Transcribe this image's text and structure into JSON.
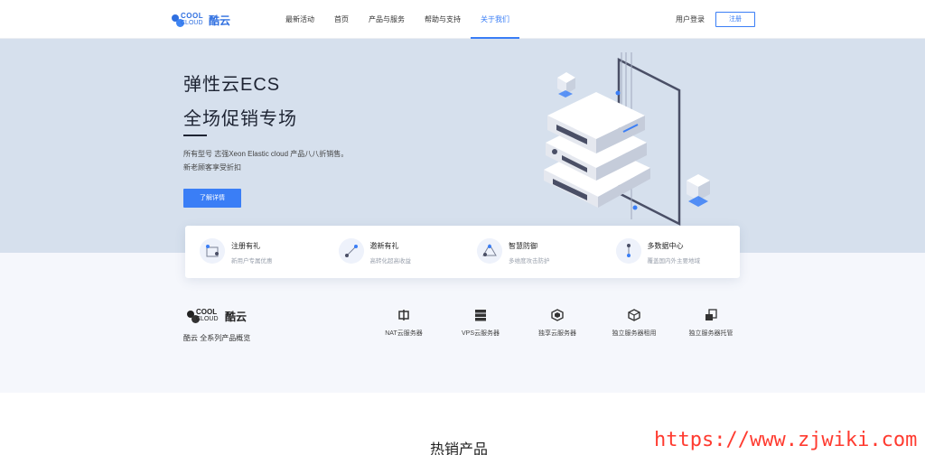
{
  "header": {
    "logo_text_en_top": "COOL",
    "logo_text_en_bottom": "CLOUD",
    "logo_text_cn": "酷云",
    "nav": [
      {
        "label": "最新活动",
        "active": false
      },
      {
        "label": "首页",
        "active": false
      },
      {
        "label": "产品与服务",
        "active": false
      },
      {
        "label": "帮助与支持",
        "active": false
      },
      {
        "label": "关于我们",
        "active": true
      }
    ],
    "login_label": "用户登录",
    "register_label": "注册"
  },
  "hero": {
    "title_line1": "弹性云ECS",
    "title_line2": "全场促销专场",
    "desc_line1": "所有型号 志强Xeon Elastic cloud 产品八八折销售。",
    "desc_line2": "新老顾客享受折扣",
    "cta_label": "了解详情"
  },
  "features": [
    {
      "title": "注册有礼",
      "subtitle": "新用户专属优惠",
      "icon": "gift-icon"
    },
    {
      "title": "邀新有礼",
      "subtitle": "高转化超高收益",
      "icon": "invite-icon"
    },
    {
      "title": "智慧防御",
      "subtitle": "多维度攻击防护",
      "icon": "shield-icon"
    },
    {
      "title": "多数据中心",
      "subtitle": "覆盖国内外主要地域",
      "icon": "datacenter-icon"
    }
  ],
  "overview": {
    "logo_text_en_top": "COOL",
    "logo_text_en_bottom": "CLOUD",
    "logo_text_cn": "酷云",
    "title": "酷云 全系列产品概览",
    "products": [
      {
        "label": "NAT云服务器",
        "icon": "nat-icon"
      },
      {
        "label": "VPS云服务器",
        "icon": "vps-icon"
      },
      {
        "label": "独享云服务器",
        "icon": "cube-icon"
      },
      {
        "label": "独立服务器租用",
        "icon": "box-icon"
      },
      {
        "label": "独立服务器托管",
        "icon": "hosting-icon"
      }
    ]
  },
  "hot_title": "热销产品",
  "watermark": "https://www.zjwiki.com",
  "colors": {
    "accent": "#3a7ef6",
    "hero_bg": "#d6e0ed",
    "overview_bg": "#f5f7fc"
  }
}
